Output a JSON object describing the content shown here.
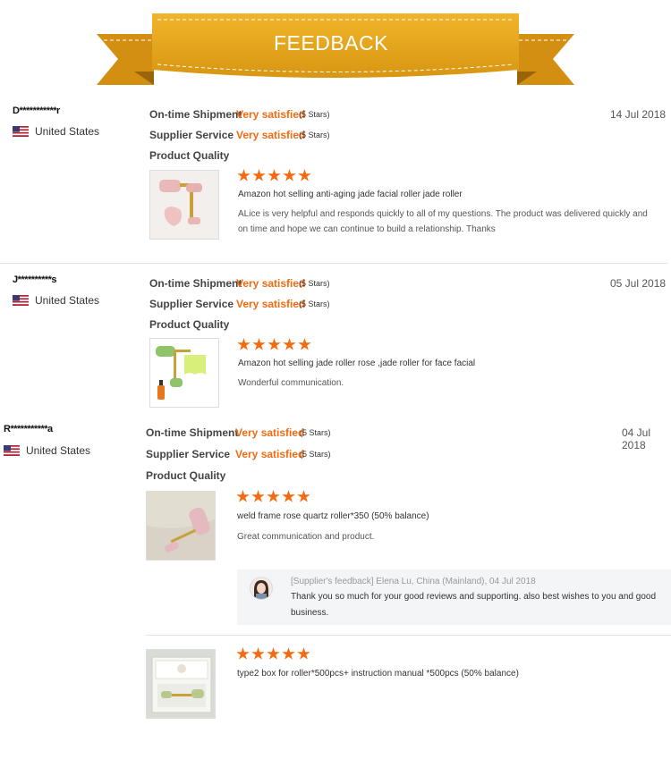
{
  "banner": {
    "title": "FEEDBACK"
  },
  "labels": {
    "shipment": "On-time Shipment",
    "service": "Supplier Service",
    "quality": "Product Quality"
  },
  "rating_value": "Very satisfied",
  "rating_stars": "(5 Stars)",
  "star_rating": 5,
  "colors": {
    "accent": "#f36a10",
    "banner": "#e3a51c"
  },
  "reviews": [
    {
      "buyer": "D***********r",
      "country": "United States",
      "date": "14 Jul 2018",
      "product": "Amazon hot selling anti-aging jade facial roller jade roller",
      "comment": "ALice is very helpful and responds quickly to all of my questions. The product was delivered quickly and on time and hope we can continue to build a relationship. Thanks"
    },
    {
      "buyer": "J**********s",
      "country": "United States",
      "date": "05 Jul 2018",
      "product": "Amazon hot selling jade roller rose ,jade roller for face facial",
      "comment": "Wonderful communication."
    },
    {
      "buyer": "R***********a",
      "country": "United States",
      "date": "04 Jul 2018",
      "product": "weld frame rose quartz roller*350 (50% balance)",
      "comment": "Great communication and product.",
      "reply": {
        "header": "[Supplier's feedback] Elena Lu, China (Mainland), 04 Jul 2018",
        "body": "Thank you so much for your good reviews and supporting. also best wishes to you and good business."
      },
      "extra_product": "type2 box for roller*500pcs+ instruction manual *500pcs (50% balance)"
    }
  ]
}
